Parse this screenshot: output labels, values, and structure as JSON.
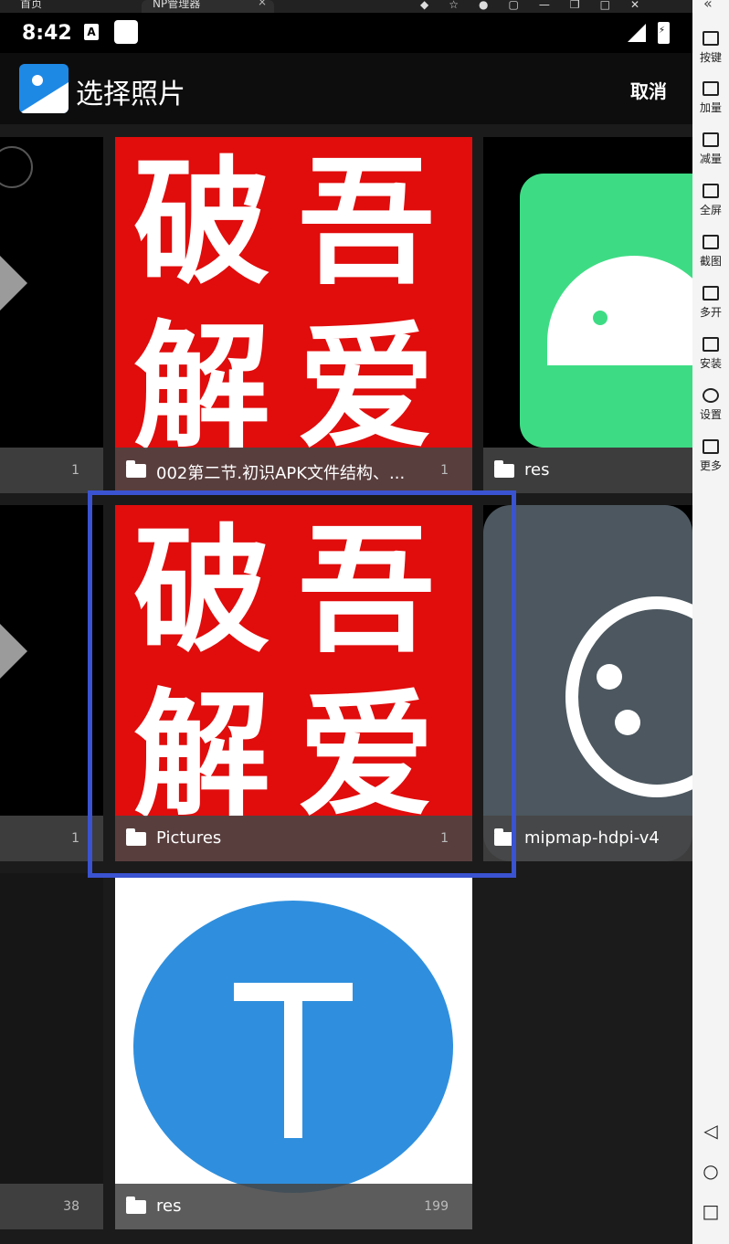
{
  "browser_tabs": [
    {
      "label": "首页"
    },
    {
      "label": "NP管理器"
    }
  ],
  "status_bar": {
    "time": "8:42",
    "a_icon": "A"
  },
  "app_bar": {
    "title": "选择照片",
    "cancel_label": "取消"
  },
  "albums": [
    {
      "name": "",
      "count": "1"
    },
    {
      "name": "002第二节.初识APK文件结构、...",
      "count": "1"
    },
    {
      "name": "res",
      "count": ""
    },
    {
      "name": "",
      "count": "1"
    },
    {
      "name": "Pictures",
      "count": "1"
    },
    {
      "name": "mipmap-hdpi-v4",
      "count": ""
    },
    {
      "name": "",
      "count": "38"
    },
    {
      "name": "res",
      "count": "199"
    }
  ],
  "seal_chars": {
    "c1": "破",
    "c2": "吾",
    "c3": "解",
    "c4": "爱"
  },
  "sidebar": {
    "items": [
      {
        "label": "按键",
        "icon": "keyboard-icon"
      },
      {
        "label": "加量",
        "icon": "volume-up-icon"
      },
      {
        "label": "减量",
        "icon": "volume-down-icon"
      },
      {
        "label": "全屏",
        "icon": "fullscreen-icon"
      },
      {
        "label": "截图",
        "icon": "scissors-icon"
      },
      {
        "label": "多开",
        "icon": "multi-instance-icon"
      },
      {
        "label": "安装",
        "icon": "apk-install-icon"
      },
      {
        "label": "设置",
        "icon": "settings-icon"
      },
      {
        "label": "更多",
        "icon": "more-icon"
      }
    ]
  },
  "colors": {
    "selection": "#3a53d1",
    "seal_red": "#e10c0c",
    "android_green": "#3ddc84"
  }
}
